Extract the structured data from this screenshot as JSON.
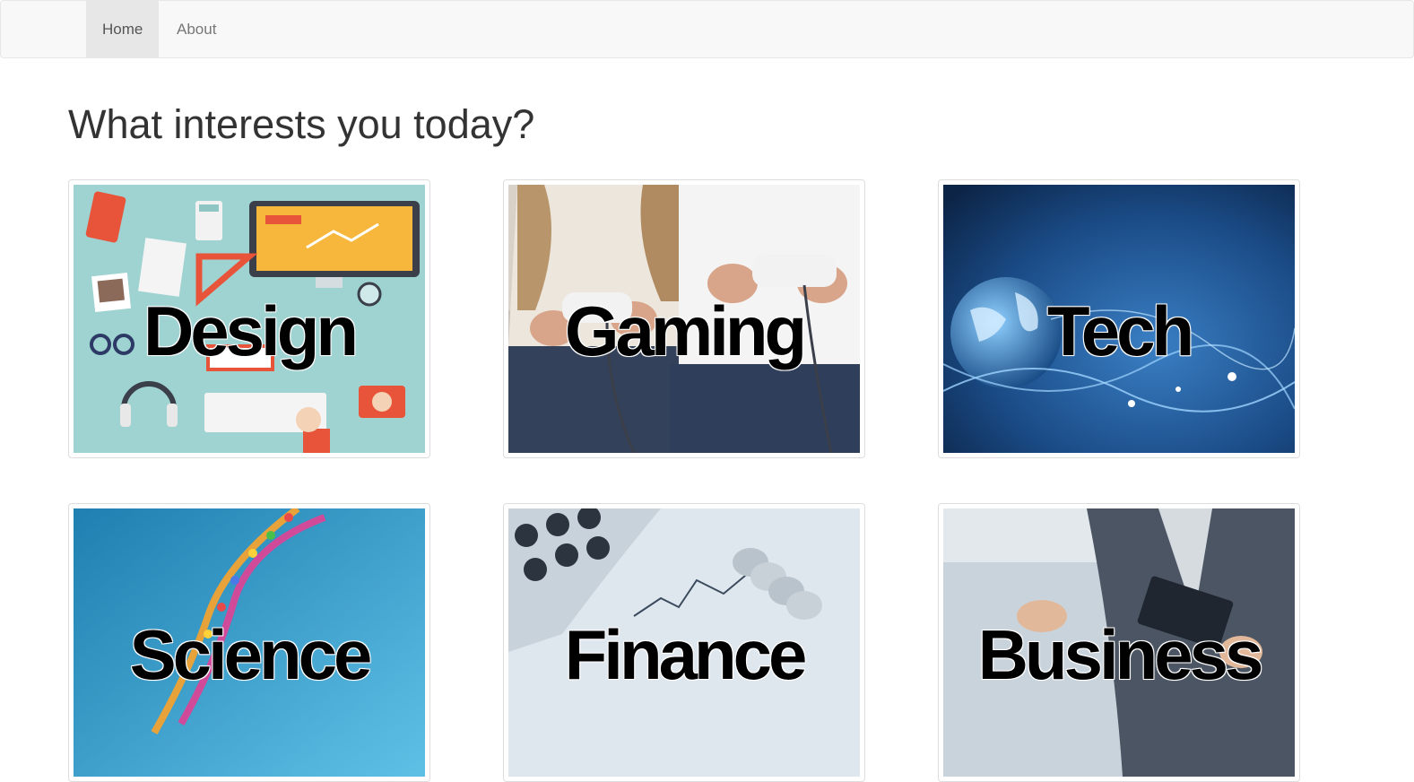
{
  "navbar": {
    "items": [
      {
        "label": "Home",
        "active": true
      },
      {
        "label": "About",
        "active": false
      }
    ]
  },
  "main": {
    "heading": "What interests you today?",
    "categories": [
      {
        "label": "Design",
        "image": "flat-lay design workspace illustration"
      },
      {
        "label": "Gaming",
        "image": "two people holding game controllers"
      },
      {
        "label": "Tech",
        "image": "glowing globe network"
      },
      {
        "label": "Science",
        "image": "DNA double helix"
      },
      {
        "label": "Finance",
        "image": "calculator, coins and stock chart"
      },
      {
        "label": "Business",
        "image": "businessman with tablet"
      }
    ]
  },
  "colors": {
    "navbar_bg": "#f8f8f8",
    "navbar_active_bg": "#e7e7e7",
    "card_border": "#dddddd",
    "heading_text": "#333333"
  }
}
